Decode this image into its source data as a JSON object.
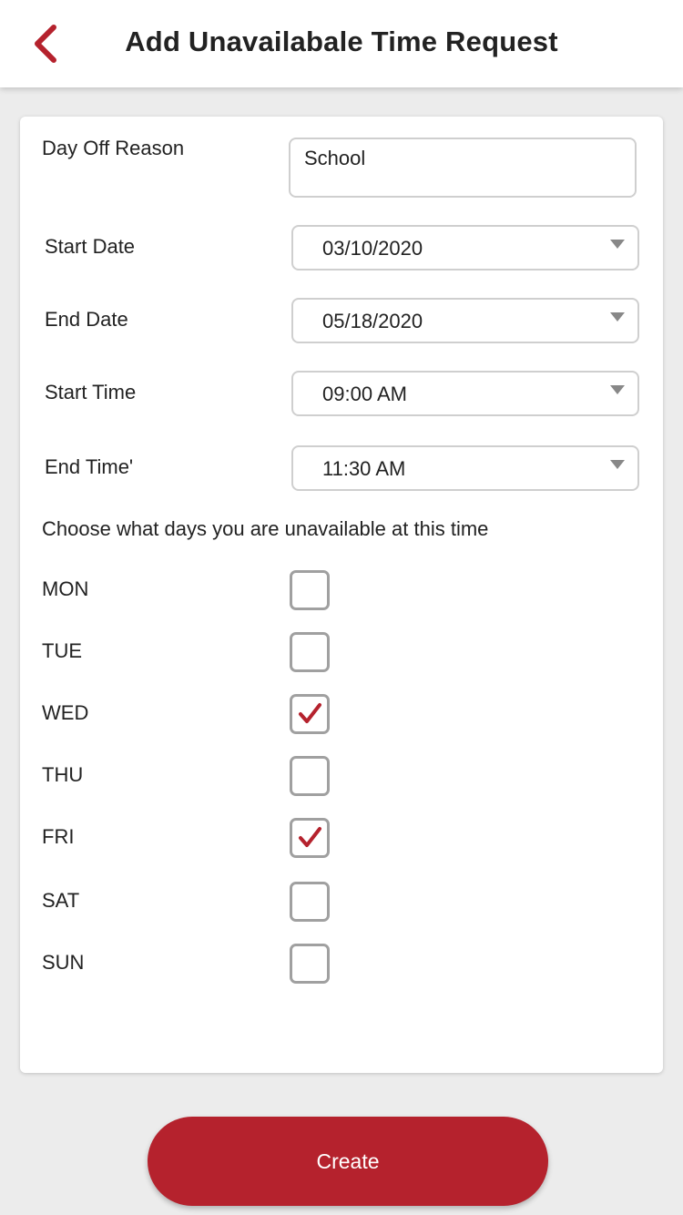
{
  "header": {
    "title": "Add Unavailabale Time Request"
  },
  "colors": {
    "accent": "#b5222d",
    "border": "#cfcfcf",
    "checkbox_border": "#a0a0a0"
  },
  "form": {
    "reason_label": "Day Off Reason",
    "reason_value": "School",
    "start_date_label": "Start Date",
    "start_date_value": "03/10/2020",
    "end_date_label": "End Date",
    "end_date_value": "05/18/2020",
    "start_time_label": "Start Time",
    "start_time_value": "09:00 AM",
    "end_time_label": "End Time'",
    "end_time_value": "11:30 AM",
    "days_instruction": "Choose what days you are unavailable at this time"
  },
  "days": [
    {
      "label": "MON",
      "checked": false
    },
    {
      "label": "TUE",
      "checked": false
    },
    {
      "label": "WED",
      "checked": true
    },
    {
      "label": "THU",
      "checked": false
    },
    {
      "label": "FRI",
      "checked": true
    },
    {
      "label": "SAT",
      "checked": false
    },
    {
      "label": "SUN",
      "checked": false
    }
  ],
  "actions": {
    "create_label": "Create"
  }
}
